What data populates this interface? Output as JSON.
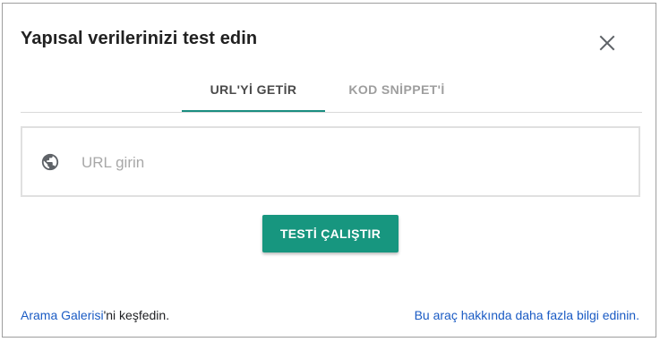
{
  "dialog": {
    "title": "Yapısal verilerinizi test edin",
    "close_icon": "close-icon"
  },
  "tabs": [
    {
      "label": "URL'Yİ GETİR",
      "active": true
    },
    {
      "label": "KOD SNİPPET'İ",
      "active": false
    }
  ],
  "url_input": {
    "icon": "globe-icon",
    "placeholder": "URL girin",
    "value": ""
  },
  "run_button": {
    "label": "TESTİ ÇALIŞTIR"
  },
  "footer": {
    "gallery_link": "Arama Galerisi",
    "gallery_suffix": "'ni keşfedin.",
    "learn_more_link": "Bu araç hakkında daha fazla bilgi edinin."
  },
  "colors": {
    "accent": "#17967f",
    "tab_underline": "#1a8d80",
    "link": "#1a5bc4"
  }
}
